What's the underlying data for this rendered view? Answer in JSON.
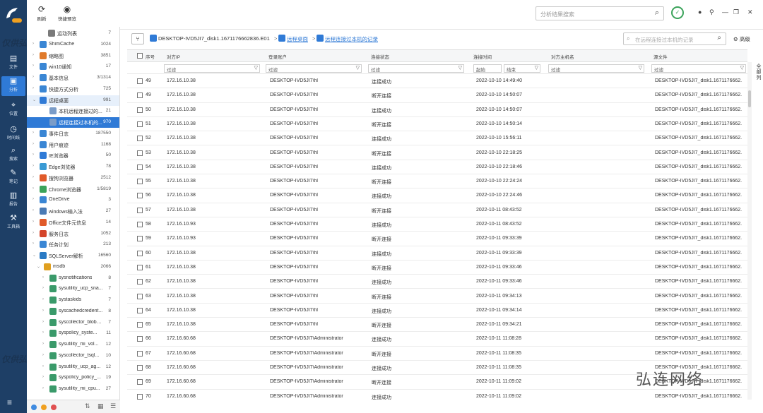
{
  "toolbar": {
    "refresh": "刷新",
    "preview": "快捷预览",
    "search_placeholder": "分析结果搜索"
  },
  "rail": [
    {
      "label": "文件",
      "icon": "folder-icon"
    },
    {
      "label": "分析",
      "icon": "analysis-icon"
    },
    {
      "label": "位置",
      "icon": "location-icon"
    },
    {
      "label": "时间线",
      "icon": "timeline-icon"
    },
    {
      "label": "搜索",
      "icon": "search-icon"
    },
    {
      "label": "笔记",
      "icon": "note-icon"
    },
    {
      "label": "报告",
      "icon": "report-icon"
    },
    {
      "label": "工具箱",
      "icon": "toolbox-icon"
    }
  ],
  "watermarks": [
    "仅供弘",
    "仅供弘"
  ],
  "brand_text": "弘连网络",
  "tree": [
    {
      "label": "运动列表",
      "count": "7"
    },
    {
      "label": "ShimCache",
      "count": "1024"
    },
    {
      "label": "缩略图",
      "count": "3851"
    },
    {
      "label": "win10通知",
      "count": "17"
    },
    {
      "label": "基本信息",
      "count": "3/1314"
    },
    {
      "label": "快捷方式分析",
      "count": "725"
    },
    {
      "label": "远程桌面",
      "count": "991"
    },
    {
      "label": "本机远程连接过的...",
      "count": "21"
    },
    {
      "label": "远程连接过本机的...",
      "count": "970"
    },
    {
      "label": "事件日志",
      "count": "187550"
    },
    {
      "label": "用户痕迹",
      "count": "1168"
    },
    {
      "label": "IE浏览器",
      "count": "50"
    },
    {
      "label": "Edge浏览器",
      "count": "78"
    },
    {
      "label": "搜狗浏览器",
      "count": "2512"
    },
    {
      "label": "Chrome浏览器",
      "count": "1/5819"
    },
    {
      "label": "OneDrive",
      "count": "3"
    },
    {
      "label": "windows输入法",
      "count": "27"
    },
    {
      "label": "Office文件元信息",
      "count": "14"
    },
    {
      "label": "服务日志",
      "count": "1052"
    },
    {
      "label": "任务计划",
      "count": "213"
    },
    {
      "label": "SQLServer解析",
      "count": "16560"
    },
    {
      "label": "msdb",
      "count": "2066"
    },
    {
      "label": "sysnotifications",
      "count": "8"
    },
    {
      "label": "sysutility_ucp_sna...",
      "count": "7"
    },
    {
      "label": "systaskids",
      "count": "7"
    },
    {
      "label": "syscachedcredent...",
      "count": "8"
    },
    {
      "label": "syscollector_blobs...",
      "count": "7"
    },
    {
      "label": "syspolicy_syste...",
      "count": "11"
    },
    {
      "label": "sysutility_mi_vol...",
      "count": "12"
    },
    {
      "label": "syscollector_tsql...",
      "count": "10"
    },
    {
      "label": "sysutility_ucp_ag...",
      "count": "12"
    },
    {
      "label": "syspolicy_policy_...",
      "count": "19"
    },
    {
      "label": "sysutility_mi_cpu...",
      "count": "27"
    }
  ],
  "breadcrumb": {
    "path": "DESKTOP-IVD5JI7_disk1.1671176662836.E01",
    "level1": "远程桌面",
    "level2": "远程连接过本机的记录",
    "search_placeholder": "在远程连接过本机的记录",
    "advanced": "高级"
  },
  "columns": [
    "序号",
    "对方IP",
    "登录账户",
    "连接状态",
    "连接时间",
    "对方主机名",
    "源文件"
  ],
  "filters": {
    "placeholder": "过滤",
    "start": "起始",
    "end": "结束"
  },
  "side_tab": "全部列",
  "rows": [
    {
      "id": "49",
      "ip": "172.16.10.38",
      "account": "DESKTOP-IVD5JI7\\hl",
      "status": "连接成功",
      "time": "2022-10-10 14:49:40",
      "host": "",
      "src": "DESKTOP-IVD5JI7_disk1.1671176662."
    },
    {
      "id": "49",
      "ip": "172.16.10.38",
      "account": "DESKTOP-IVD5JI7\\hl",
      "status": "断开连接",
      "time": "2022-10-10 14:50:07",
      "host": "",
      "src": "DESKTOP-IVD5JI7_disk1.1671176662."
    },
    {
      "id": "50",
      "ip": "172.16.10.38",
      "account": "DESKTOP-IVD5JI7\\hl",
      "status": "连接成功",
      "time": "2022-10-10 14:50:07",
      "host": "",
      "src": "DESKTOP-IVD5JI7_disk1.1671176662."
    },
    {
      "id": "51",
      "ip": "172.16.10.38",
      "account": "DESKTOP-IVD5JI7\\hl",
      "status": "断开连接",
      "time": "2022-10-10 14:50:14",
      "host": "",
      "src": "DESKTOP-IVD5JI7_disk1.1671176662."
    },
    {
      "id": "52",
      "ip": "172.16.10.38",
      "account": "DESKTOP-IVD5JI7\\hl",
      "status": "连接成功",
      "time": "2022-10-10 15:56:11",
      "host": "",
      "src": "DESKTOP-IVD5JI7_disk1.1671176662."
    },
    {
      "id": "53",
      "ip": "172.16.10.38",
      "account": "DESKTOP-IVD5JI7\\hl",
      "status": "断开连接",
      "time": "2022-10-10 22:18:25",
      "host": "",
      "src": "DESKTOP-IVD5JI7_disk1.1671176662."
    },
    {
      "id": "54",
      "ip": "172.16.10.38",
      "account": "DESKTOP-IVD5JI7\\hl",
      "status": "连接成功",
      "time": "2022-10-10 22:18:46",
      "host": "",
      "src": "DESKTOP-IVD5JI7_disk1.1671176662."
    },
    {
      "id": "55",
      "ip": "172.16.10.38",
      "account": "DESKTOP-IVD5JI7\\hl",
      "status": "断开连接",
      "time": "2022-10-10 22:24:24",
      "host": "",
      "src": "DESKTOP-IVD5JI7_disk1.1671176662."
    },
    {
      "id": "56",
      "ip": "172.16.10.38",
      "account": "DESKTOP-IVD5JI7\\hl",
      "status": "连接成功",
      "time": "2022-10-10 22:24:46",
      "host": "",
      "src": "DESKTOP-IVD5JI7_disk1.1671176662."
    },
    {
      "id": "57",
      "ip": "172.16.10.38",
      "account": "DESKTOP-IVD5JI7\\hl",
      "status": "断开连接",
      "time": "2022-10-11 08:43:52",
      "host": "",
      "src": "DESKTOP-IVD5JI7_disk1.1671176662."
    },
    {
      "id": "58",
      "ip": "172.16.10.93",
      "account": "DESKTOP-IVD5JI7\\hl",
      "status": "连接成功",
      "time": "2022-10-11 08:43:52",
      "host": "",
      "src": "DESKTOP-IVD5JI7_disk1.1671176662."
    },
    {
      "id": "59",
      "ip": "172.16.10.93",
      "account": "DESKTOP-IVD5JI7\\hl",
      "status": "断开连接",
      "time": "2022-10-11 09:33:39",
      "host": "",
      "src": "DESKTOP-IVD5JI7_disk1.1671176662."
    },
    {
      "id": "60",
      "ip": "172.16.10.38",
      "account": "DESKTOP-IVD5JI7\\hl",
      "status": "连接成功",
      "time": "2022-10-11 09:33:39",
      "host": "",
      "src": "DESKTOP-IVD5JI7_disk1.1671176662."
    },
    {
      "id": "61",
      "ip": "172.16.10.38",
      "account": "DESKTOP-IVD5JI7\\hl",
      "status": "断开连接",
      "time": "2022-10-11 09:33:46",
      "host": "",
      "src": "DESKTOP-IVD5JI7_disk1.1671176662."
    },
    {
      "id": "62",
      "ip": "172.16.10.38",
      "account": "DESKTOP-IVD5JI7\\hl",
      "status": "连接成功",
      "time": "2022-10-11 09:33:46",
      "host": "",
      "src": "DESKTOP-IVD5JI7_disk1.1671176662."
    },
    {
      "id": "63",
      "ip": "172.16.10.38",
      "account": "DESKTOP-IVD5JI7\\hl",
      "status": "断开连接",
      "time": "2022-10-11 09:34:13",
      "host": "",
      "src": "DESKTOP-IVD5JI7_disk1.1671176662."
    },
    {
      "id": "64",
      "ip": "172.16.10.38",
      "account": "DESKTOP-IVD5JI7\\hl",
      "status": "连接成功",
      "time": "2022-10-11 09:34:14",
      "host": "",
      "src": "DESKTOP-IVD5JI7_disk1.1671176662."
    },
    {
      "id": "65",
      "ip": "172.16.10.38",
      "account": "DESKTOP-IVD5JI7\\hl",
      "status": "断开连接",
      "time": "2022-10-11 09:34:21",
      "host": "",
      "src": "DESKTOP-IVD5JI7_disk1.1671176662."
    },
    {
      "id": "66",
      "ip": "172.16.60.68",
      "account": "DESKTOP-IVD5JI7\\Administrator",
      "status": "连接成功",
      "time": "2022-10-11 11:08:28",
      "host": "",
      "src": "DESKTOP-IVD5JI7_disk1.1671176662."
    },
    {
      "id": "67",
      "ip": "172.16.60.68",
      "account": "DESKTOP-IVD5JI7\\Administrator",
      "status": "断开连接",
      "time": "2022-10-11 11:08:35",
      "host": "",
      "src": "DESKTOP-IVD5JI7_disk1.1671176662."
    },
    {
      "id": "68",
      "ip": "172.16.60.68",
      "account": "DESKTOP-IVD5JI7\\Administrator",
      "status": "连接成功",
      "time": "2022-10-11 11:08:35",
      "host": "",
      "src": "DESKTOP-IVD5JI7_disk1.1671176662."
    },
    {
      "id": "69",
      "ip": "172.16.60.68",
      "account": "DESKTOP-IVD5JI7\\Administrator",
      "status": "断开连接",
      "time": "2022-10-11 11:09:02",
      "host": "",
      "src": "DESKTOP-IVD5JI7_disk1.1671176662."
    },
    {
      "id": "70",
      "ip": "172.16.60.68",
      "account": "DESKTOP-IVD5JI7\\Administrator",
      "status": "连接成功",
      "time": "2022-10-11 11:09:02",
      "host": "",
      "src": "DESKTOP-IVD5JI7_disk1.1671176662."
    }
  ],
  "colors": {
    "rail": "#1e3f66",
    "accent": "#2f7ad6",
    "ok": "#3aa35a"
  }
}
